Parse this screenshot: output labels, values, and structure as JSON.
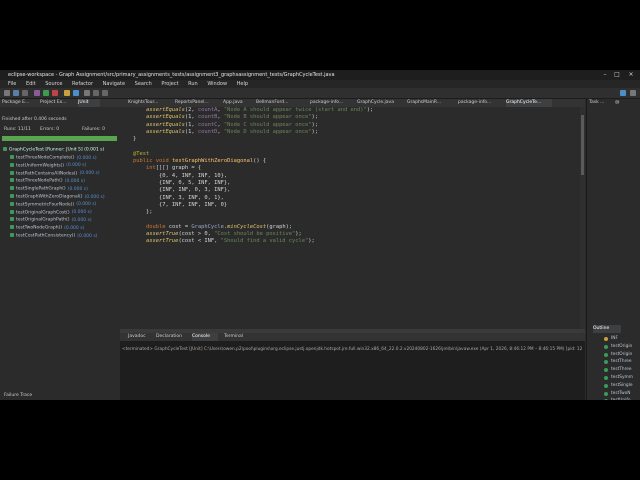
{
  "window": {
    "title": "eclipse-workspace - Graph Assignment/src/primary_assignments_tests/assignment3_graphsassignment_tests/GraphCycleTest.java"
  },
  "menu": [
    "File",
    "Edit",
    "Source",
    "Refactor",
    "Navigate",
    "Search",
    "Project",
    "Run",
    "Window",
    "Help"
  ],
  "left_tabs": [
    "Package E...",
    "Project Ex...",
    "JUnit"
  ],
  "junit": {
    "finished": "Finished after 0.406 seconds",
    "runs": "Runs: 11/11",
    "errors": "Errors: 0",
    "failures": "Failures: 0",
    "root": "GraphCycleTest [Runner: JUnit 5] (0.001 s)",
    "tests": [
      {
        "name": "testThreeNodeComplete()",
        "time": "(0.000 s)"
      },
      {
        "name": "testUniformWeights()",
        "time": "(0.000 s)"
      },
      {
        "name": "testPathContainsAllNodes()",
        "time": "(0.000 s)"
      },
      {
        "name": "testThreeNodePath()",
        "time": "(0.000 s)"
      },
      {
        "name": "testSinglePathGraph()",
        "time": "(0.000 s)"
      },
      {
        "name": "testGraphWithZeroDiagonal()",
        "time": "(0.000 s)"
      },
      {
        "name": "testSymmetricFourNode()",
        "time": "(0.000 s)"
      },
      {
        "name": "testOriginalGraphCost()",
        "time": "(0.000 s)"
      },
      {
        "name": "testOriginalGraphPath()",
        "time": "(0.000 s)"
      },
      {
        "name": "testTwoNodeGraph()",
        "time": "(0.000 s)"
      },
      {
        "name": "testCostPathConsistency()",
        "time": "(0.000 s)"
      }
    ],
    "failure_trace": "Failure Trace"
  },
  "editor_tabs": [
    "KnightsTour...",
    "ReportsPanel...",
    "App.java",
    "BellmanFord...",
    "package-info...",
    "GraphCycle.java",
    "GraphsMainR...",
    "package-info...",
    "GraphCycleTe..."
  ],
  "code": {
    "l1": {
      "m": "assertEquals",
      "a": "(2, ",
      "v": "countA",
      "s": "\"Node A should appear twice (start and end)\"",
      "e": ");"
    },
    "l2": {
      "m": "assertEquals",
      "a": "(1, ",
      "v": "countB",
      "s": "\"Node B should appear once\"",
      "e": ");"
    },
    "l3": {
      "m": "assertEquals",
      "a": "(1, ",
      "v": "countC",
      "s": "\"Node C should appear once\"",
      "e": ");"
    },
    "l4": {
      "m": "assertEquals",
      "a": "(1, ",
      "v": "countD",
      "s": "\"Node D should appear once\"",
      "e": ");"
    },
    "l5": "}",
    "ann": "@Test",
    "sig_kw": "public void ",
    "sig_name": "testGraphWithZeroDiagonal",
    "sig_end": "() {",
    "decl_kw": "int",
    "decl_rest": "[][] graph = {",
    "rows": [
      "{0, 4, INF, INF, 10},",
      "{INF, 0, 5, INF, INF},",
      "{INF, INF, 0, 3, INF},",
      "{INF, 3, INF, 0, 1},",
      "{7, INF, INF, INF, 0}"
    ],
    "close": "};",
    "cost_kw": "double",
    "cost_var": " cost = ",
    "cost_cls": "GraphCycle",
    "cost_m": "minCycleCost",
    "cost_end": "(graph);",
    "at1_m": "assertTrue",
    "at1_a": "(cost > 0, ",
    "at1_s": "\"Cost should be positive\"",
    "at1_e": ");",
    "at2_m": "assertTrue",
    "at2_a": "(cost < INF, ",
    "at2_s": "\"Should find a valid cycle\"",
    "at2_e": ");"
  },
  "bottom_tabs": [
    "Javadoc",
    "Declaration",
    "Console",
    "Terminal"
  ],
  "console_text": "<terminated> GraphCycleTest [JUnit] C:\\Users\\owen.p2\\pool\\plugins\\org.eclipse.justj.openjdk.hotspot.jre.full.win32.x86_64_22.0.2.v20240802-1626\\jre\\bin\\javaw.exe  (Apr 1, 2026, 8:46:12 PM – 8:46:15 PM) [pid: 12",
  "right_top_tabs": [
    "Task ...",
    "@"
  ],
  "outline": {
    "title": "Outline",
    "items": [
      "INF",
      "testOrigin",
      "testOrigin",
      "testThree",
      "testThree",
      "testSymm",
      "testSingle",
      "testTwoN",
      "testUnifo",
      "testPathC",
      "testGraph",
      "testCostP",
      "countOcc",
      "calculateT"
    ]
  },
  "colors": {
    "accent": "#3c9b5a",
    "progress": "#59a54f"
  }
}
